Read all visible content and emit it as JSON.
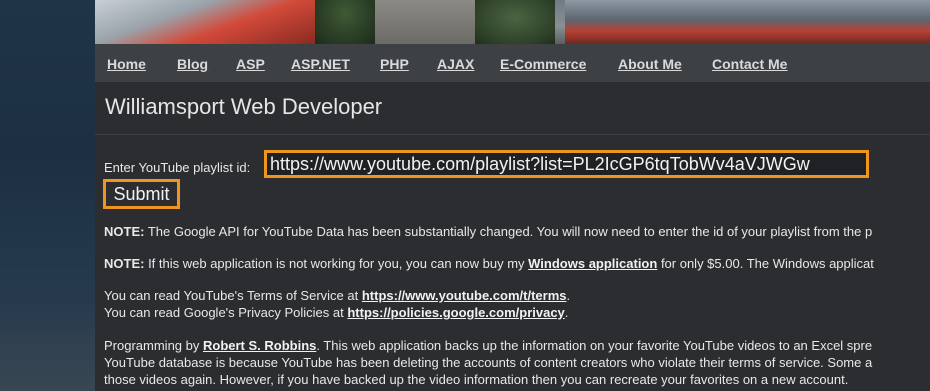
{
  "nav": {
    "items": [
      "Home",
      "Blog",
      "ASP",
      "ASP.NET",
      "PHP",
      "AJAX",
      "E-Commerce",
      "About Me",
      "Contact Me"
    ]
  },
  "site": {
    "title": "Williamsport Web Developer"
  },
  "form": {
    "label": "Enter YouTube playlist id:",
    "playlist_value": "https://www.youtube.com/playlist?list=PL2IcGP6tqTobWv4aVJWGw",
    "submit_label": "Submit"
  },
  "note1": {
    "prefix": "NOTE:",
    "text": " The Google API for YouTube Data has been substantially changed. You will now need to enter the id of your playlist from the p"
  },
  "note2": {
    "prefix": "NOTE:",
    "text_before": " If this web application is not working for you, you can now buy my ",
    "link": "Windows application",
    "text_after": " for only $5.00. The Windows applicat"
  },
  "terms": {
    "line1_text": "You can read YouTube's Terms of Service at ",
    "line1_link": "https://www.youtube.com/t/terms",
    "line1_end": ".",
    "line2_text": "You can read Google's Privacy Policies at ",
    "line2_link": "https://policies.google.com/privacy",
    "line2_end": "."
  },
  "programming": {
    "text_before": "Programming by ",
    "author_link": "Robert S. Robbins",
    "text_after": ". This web application backs up the information on your favorite YouTube videos to an Excel spre",
    "line2": "YouTube database is because YouTube has been deleting the accounts of content creators who violate their terms of service. Some a",
    "line3": "those videos again. However, if you have backed up the video information then you can recreate your favorites on a new account."
  }
}
